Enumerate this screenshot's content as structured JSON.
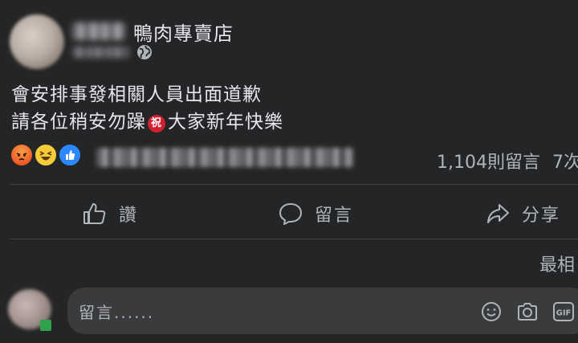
{
  "post": {
    "page_name": "鴨肉專賣店",
    "body_line1": "會安排事發相關人員出面道歉",
    "body_line2_before": "請各位稍安勿躁",
    "celebrate_char": "祝",
    "body_line2_after": "大家新年快樂"
  },
  "stats": {
    "reactions": [
      "angry-icon",
      "haha-icon",
      "like-icon"
    ],
    "comments_text": "1,104則留言",
    "shares_text": "7次"
  },
  "actions": {
    "like": "讚",
    "comment": "留言",
    "share": "分享"
  },
  "comments": {
    "sort_label": "最相",
    "placeholder": "留言......"
  },
  "colors": {
    "background": "#242526",
    "text": "#e4e6eb",
    "secondary": "#b0b3b8",
    "like_blue": "#2d88ff",
    "angry_orange": "#ec5b26",
    "haha_yellow": "#f7cc3a",
    "celebrate_red": "#d2202f"
  }
}
